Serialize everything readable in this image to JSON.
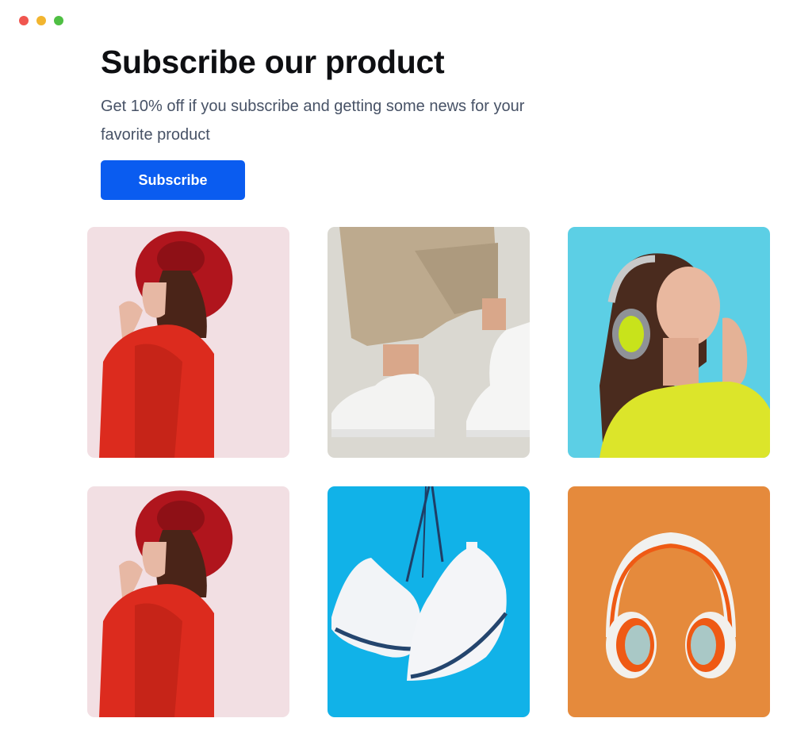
{
  "window": {
    "controls": [
      "close",
      "minimize",
      "maximize"
    ]
  },
  "hero": {
    "title": "Subscribe our product",
    "description": "Get 10% off if you subscribe and getting some news for your favorite product",
    "button_label": "Subscribe"
  },
  "colors": {
    "accent": "#0a5cf0",
    "title": "#0e0f12",
    "body_text": "#475266"
  },
  "products": [
    {
      "name": "woman-red-hat-image",
      "background": "#f2dfe3"
    },
    {
      "name": "white-sneakers-walking-image",
      "background": "#dad8d1"
    },
    {
      "name": "woman-headphones-image",
      "background": "#5ccfe5"
    },
    {
      "name": "woman-red-hat-image-2",
      "background": "#f2dfe3"
    },
    {
      "name": "hanging-sneakers-image",
      "background": "#11b2e8"
    },
    {
      "name": "orange-headphones-image",
      "background": "#e58a3c"
    }
  ]
}
